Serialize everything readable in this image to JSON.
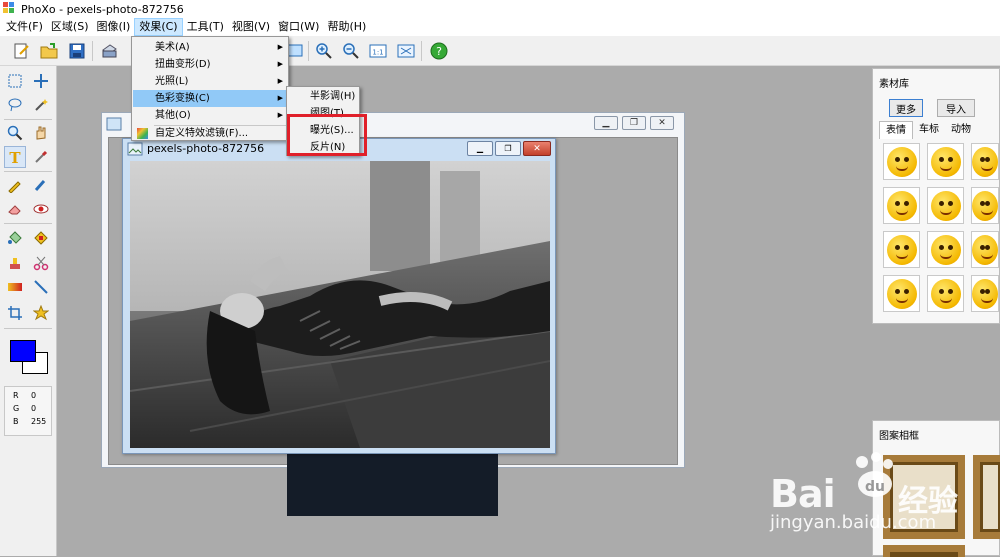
{
  "window": {
    "title": "PhoXo - pexels-photo-872756"
  },
  "menubar": {
    "items": [
      {
        "label": "文件(F)"
      },
      {
        "label": "区域(S)"
      },
      {
        "label": "图像(I)"
      },
      {
        "label": "效果(C)"
      },
      {
        "label": "工具(T)"
      },
      {
        "label": "视图(V)"
      },
      {
        "label": "窗口(W)"
      },
      {
        "label": "帮助(H)"
      }
    ]
  },
  "effects_menu": {
    "items": [
      {
        "label": "美术(A)"
      },
      {
        "label": "扭曲变形(D)"
      },
      {
        "label": "光照(L)"
      },
      {
        "label": "色彩变换(C)"
      },
      {
        "label": "其他(O)"
      },
      {
        "label": "自定义特效滤镜(F)..."
      }
    ]
  },
  "color_transform_submenu": {
    "items": [
      {
        "label": "半影调(H)"
      },
      {
        "label": "阈图(T)..."
      },
      {
        "label": "曝光(S)..."
      },
      {
        "label": "反片(N)"
      }
    ],
    "highlight_color": "#e0202a"
  },
  "document": {
    "title": "pexels-photo-872756"
  },
  "colors": {
    "foreground": "#0000ff",
    "background": "#ffffff"
  },
  "rgb_readout": {
    "r_label": "R",
    "r_value": "0",
    "g_label": "G",
    "g_value": "0",
    "b_label": "B",
    "b_value": "255"
  },
  "materials_panel": {
    "title": "素材库",
    "more_button": "更多",
    "import_button": "导入",
    "tabs": [
      {
        "label": "表情"
      },
      {
        "label": "车标"
      },
      {
        "label": "动物"
      }
    ]
  },
  "frames_panel": {
    "title": "图案相框"
  },
  "watermark": {
    "brand": "Bai",
    "brand2": "经验",
    "url": "jingyan.baidu.com"
  }
}
